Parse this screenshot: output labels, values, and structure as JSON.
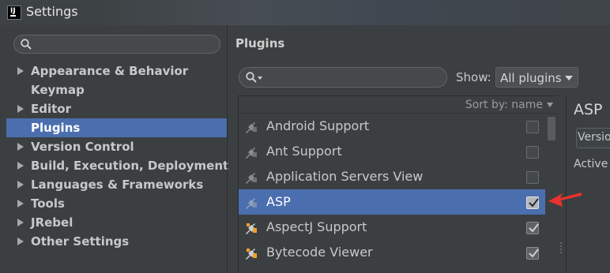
{
  "window": {
    "title": "Settings",
    "icon": "intellij-app-icon"
  },
  "sidebar": {
    "search": {
      "value": "",
      "placeholder": ""
    },
    "items": [
      {
        "label": "Appearance & Behavior",
        "expandable": true,
        "selected": false
      },
      {
        "label": "Keymap",
        "expandable": false,
        "selected": false
      },
      {
        "label": "Editor",
        "expandable": true,
        "selected": false
      },
      {
        "label": "Plugins",
        "expandable": false,
        "selected": true
      },
      {
        "label": "Version Control",
        "expandable": true,
        "selected": false
      },
      {
        "label": "Build, Execution, Deployment",
        "expandable": true,
        "selected": false
      },
      {
        "label": "Languages & Frameworks",
        "expandable": true,
        "selected": false
      },
      {
        "label": "Tools",
        "expandable": true,
        "selected": false
      },
      {
        "label": "JRebel",
        "expandable": true,
        "selected": false
      },
      {
        "label": "Other Settings",
        "expandable": true,
        "selected": false
      }
    ]
  },
  "plugins": {
    "title": "Plugins",
    "search": {
      "value": "",
      "placeholder": ""
    },
    "show_label": "Show:",
    "show_value": "All plugins",
    "sort_label": "Sort by: name",
    "list": [
      {
        "name": "Android Support",
        "checked": false,
        "selected": false,
        "icon": "plugin-icon-disabled"
      },
      {
        "name": "Ant Support",
        "checked": false,
        "selected": false,
        "icon": "plugin-icon-disabled"
      },
      {
        "name": "Application Servers View",
        "checked": false,
        "selected": false,
        "icon": "plugin-icon-disabled"
      },
      {
        "name": "ASP",
        "checked": true,
        "selected": true,
        "icon": "plugin-icon-disabled"
      },
      {
        "name": "AspectJ Support",
        "checked": true,
        "selected": false,
        "icon": "plugin-icon-enabled"
      },
      {
        "name": "Bytecode Viewer",
        "checked": true,
        "selected": false,
        "icon": "plugin-icon-enabled"
      }
    ]
  },
  "detail": {
    "title": "ASP",
    "version_label": "Version",
    "active_label": "Active S"
  },
  "colors": {
    "selection": "#4b6eaf",
    "background": "#3c3f41",
    "annotation_arrow": "#e8322e"
  }
}
